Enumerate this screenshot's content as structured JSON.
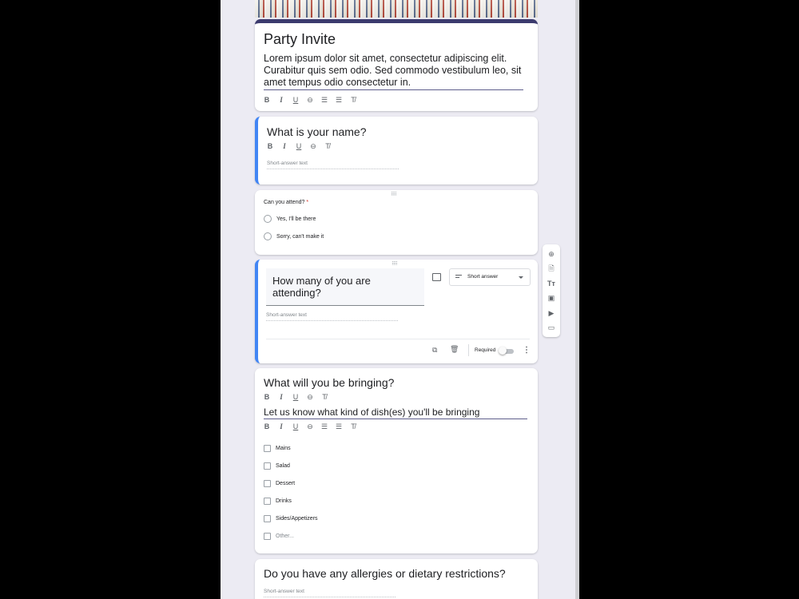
{
  "header": {
    "title": "Party Invite",
    "description": "Lorem ipsum dolor sit amet, consectetur adipiscing elit. Curabitur quis sem odio. Sed commodo vestibulum leo, sit amet tempus odio consectetur in."
  },
  "formatting": {
    "bold": "B",
    "italic": "I",
    "underline": "U",
    "clear": "T̸"
  },
  "questions": {
    "name": {
      "title": "What is your name?",
      "answer_placeholder": "Short-answer text"
    },
    "attend": {
      "title": "Can you attend?",
      "required_mark": "*",
      "options": [
        "Yes,  I'll be there",
        "Sorry, can't make it"
      ]
    },
    "count": {
      "title": "How many of you are attending?",
      "type_label": "Short answer",
      "answer_placeholder": "Short-answer text",
      "required_label": "Required"
    },
    "bringing": {
      "title": "What will you be bringing?",
      "description": "Let us know what kind of dish(es) you'll be bringing",
      "options": [
        "Mains",
        "Salad",
        "Dessert",
        "Drinks",
        "Sides/Appetizers",
        "Other..."
      ]
    },
    "allergies": {
      "title": "Do you have any allergies or dietary restrictions?",
      "answer_placeholder": "Short-answer text"
    }
  },
  "side_toolbar": {
    "icons": [
      "add-question-icon",
      "import-questions-icon",
      "add-title-icon",
      "add-image-icon",
      "add-video-icon",
      "add-section-icon"
    ]
  },
  "colors": {
    "theme": "#3c3b6e",
    "active_accent": "#4285f4",
    "background": "#ecebf3"
  }
}
